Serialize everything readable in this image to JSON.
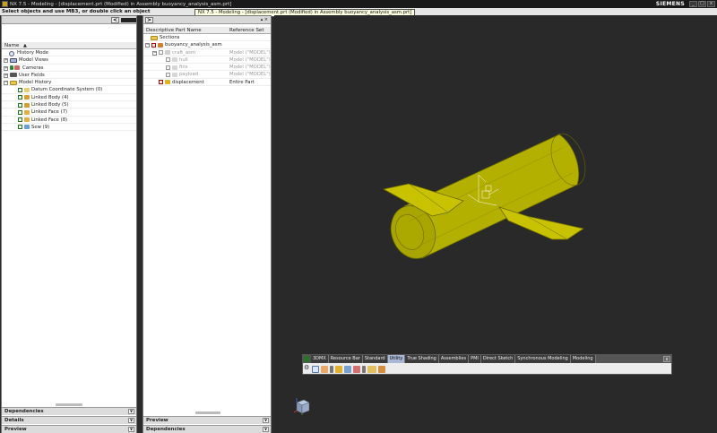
{
  "window": {
    "title": "NX 7.5 - Modeling - [displacement.prt (Modified)  in Assembly buoyancy_analysis_asm.prt]",
    "brand": "SIEMENS",
    "minimize": "_",
    "restore": "□",
    "close": "x"
  },
  "status": {
    "prompt": "Select objects and use MB3, or double click an object",
    "tooltip": "NX 7.5 - Modeling - [displacement.prt (Modified)  in Assembly buoyancy_analysis_asm.prt]"
  },
  "part_navigator": {
    "nav_back": "<",
    "columns": {
      "name": "Name",
      "sort_icon": "sort-ascending-icon"
    },
    "items": [
      {
        "label": "History Mode",
        "icon": "clock-icon"
      },
      {
        "label": "Model Views",
        "icon": "camera-views-icon"
      },
      {
        "label": "Cameras",
        "icon": "camera-icon"
      },
      {
        "label": "User Fields",
        "icon": "user-fields-icon"
      },
      {
        "label": "Model History",
        "icon": "folder-icon"
      },
      {
        "label": "Datum Coordinate System (0)",
        "icon": "datum-csys-icon"
      },
      {
        "label": "Linked Body (4)",
        "icon": "linked-body-icon"
      },
      {
        "label": "Linked Body (5)",
        "icon": "linked-body-icon"
      },
      {
        "label": "Linked Face (7)",
        "icon": "linked-face-icon"
      },
      {
        "label": "Linked Face (8)",
        "icon": "linked-face-icon"
      },
      {
        "label": "Sew (9)",
        "icon": "sew-icon"
      }
    ],
    "footers": [
      "Dependencies",
      "Details",
      "Preview"
    ]
  },
  "assembly_navigator": {
    "nav_forward": ">",
    "columns": {
      "name": "Descriptive Part Name",
      "ref": "Reference Set"
    },
    "items": [
      {
        "label": "Sections",
        "ref": ""
      },
      {
        "label": "buoyancy_analysis_asm",
        "ref": ""
      },
      {
        "label": "craft_asm",
        "ref": "Model (\"MODEL\")"
      },
      {
        "label": "hull",
        "ref": "Model (\"MODEL\")"
      },
      {
        "label": "fins",
        "ref": "Model (\"MODEL\")"
      },
      {
        "label": "payload",
        "ref": "Model (\"MODEL\")"
      },
      {
        "label": "displacement",
        "ref": "Entire Part"
      }
    ],
    "footers": [
      "Preview",
      "Dependencies"
    ]
  },
  "toolbar": {
    "tabs": [
      "3DMX",
      "Resource Bar",
      "Standard",
      "Utility",
      "True Shading",
      "Assemblies",
      "PMI",
      "Direct Sketch",
      "Synchronous Modeling",
      "Modeling"
    ],
    "active_tab": "Utility",
    "close": "x"
  },
  "colors": {
    "model_fill": "#b3b000",
    "model_edge": "#6a6a00",
    "viewport_bg": "#292929"
  }
}
